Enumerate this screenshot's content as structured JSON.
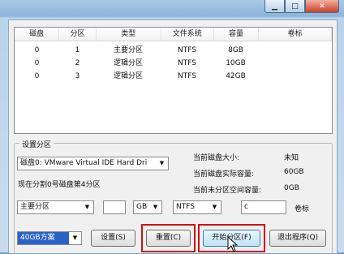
{
  "window": {
    "minimize_glyph": "▁",
    "maximize_glyph": "□",
    "close_glyph": "✕"
  },
  "table": {
    "headers": [
      "磁盘",
      "分区",
      "类型",
      "文件系统",
      "容量",
      "卷标"
    ],
    "rows": [
      [
        "0",
        "1",
        "主要分区",
        "NTFS",
        "8GB",
        ""
      ],
      [
        "0",
        "2",
        "逻辑分区",
        "NTFS",
        "10GB",
        ""
      ],
      [
        "0",
        "3",
        "逻辑分区",
        "NTFS",
        "42GB",
        ""
      ]
    ]
  },
  "settings": {
    "group_title": "设置分区",
    "disk_select": "磁盘0: VMware Virtual IDE Hard Dri",
    "status_text": "现在分割0号磁盘第4分区",
    "size_label": "当前磁盘大小:",
    "size_value": "未知",
    "actual_label": "当前磁盘实际容量:",
    "actual_value": "60GB",
    "unpartitioned_label": "当前未分区空间容量:",
    "unpartitioned_value": "0GB",
    "partition_type": "主要分区",
    "size_input": "",
    "unit_select": "GB",
    "fs_select": "NTFS",
    "label_input": "c",
    "label_caption": "卷标",
    "scheme_select": "40GB方案",
    "btn_set": "设置(S)",
    "btn_reset": "重置(C)",
    "btn_start": "开始分区(F)",
    "btn_exit": "退出程序(Q)"
  }
}
